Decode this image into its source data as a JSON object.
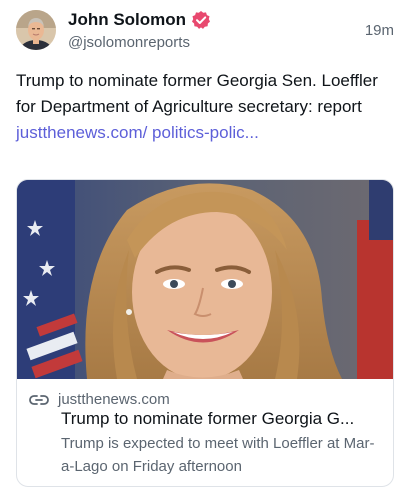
{
  "author": {
    "display_name": "John Solomon",
    "handle": "@jsolomonreports",
    "verified": true,
    "avatar_icon": "profile-photo"
  },
  "post": {
    "timestamp": "19m",
    "text": "Trump to nominate former Georgia Sen. Loeffler for Department of Agriculture secretary: report ",
    "link_text": "justthenews.com/ politics-polic..."
  },
  "card": {
    "image_icon": "portrait-photo",
    "link_icon": "link-icon",
    "domain": "justthenews.com",
    "title": "Trump to nominate former Georgia G...",
    "description": "Trump is expected to meet with Loeffler at Mar-a-Lago on Friday afternoon"
  },
  "colors": {
    "link": "#5d5fd9",
    "verified_badge": "#e8496f",
    "muted_text": "#5b6570",
    "border": "#dfe3e8"
  }
}
